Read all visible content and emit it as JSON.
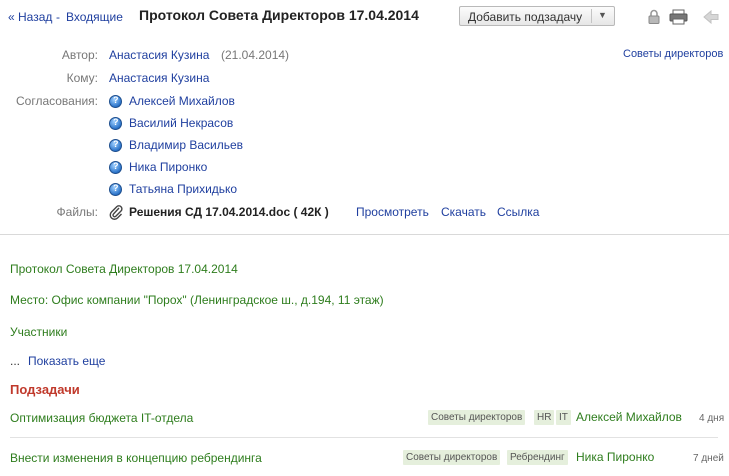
{
  "header": {
    "back_label": "« Назад",
    "separator": "-",
    "inbox_label": "Входящие",
    "title": "Протокол Совета Директоров 17.04.2014",
    "add_subtask_label": "Добавить подзадачу"
  },
  "meta": {
    "author_label": "Автор:",
    "author_name": "Анастасия Кузина",
    "author_date": "(21.04.2014)",
    "board_link": "Советы директоров",
    "to_label": "Кому:",
    "to_name": "Анастасия Кузина",
    "approvals_label": "Согласования:",
    "approvals": [
      "Алексей Михайлов",
      "Василий Некрасов",
      "Владимир Васильев",
      "Ника Пиронко",
      "Татьяна Прихидько"
    ],
    "files_label": "Файлы:",
    "file_name": "Решения СД 17.04.2014.doc ( 42К )",
    "file_view": "Просмотреть",
    "file_download": "Скачать",
    "file_link": "Ссылка"
  },
  "content": {
    "heading": "Протокол Совета Директоров 17.04.2014",
    "place": "Место: Офис компании \"Порох\" (Ленинградское ш., д.194, 11 этаж)",
    "participants": "Участники",
    "ellipsis": "...",
    "show_more": "Показать еще",
    "subtasks_title": "Подзадачи"
  },
  "subtasks": [
    {
      "title": "Оптимизация бюджета IT-отдела",
      "tags": [
        "Советы директоров",
        "HR",
        "IT"
      ],
      "assignee": "Алексей Михайлов",
      "due": "4 дня"
    },
    {
      "title": "Внести изменения в концепцию ребрендинга",
      "tags": [
        "Советы директоров",
        "Ребрендинг"
      ],
      "assignee": "Ника Пиронко",
      "due": "7 дней"
    }
  ],
  "icons": {
    "lock": "lock-icon",
    "print": "printer-icon",
    "back": "back-arrow-icon",
    "approval_status": "question-icon",
    "attachment": "paperclip-icon"
  },
  "colors": {
    "link": "#1f3f9f",
    "green_text": "#2e7d1d",
    "subtasks_title": "#c0392b",
    "tag_bg": "#e5efdc"
  }
}
